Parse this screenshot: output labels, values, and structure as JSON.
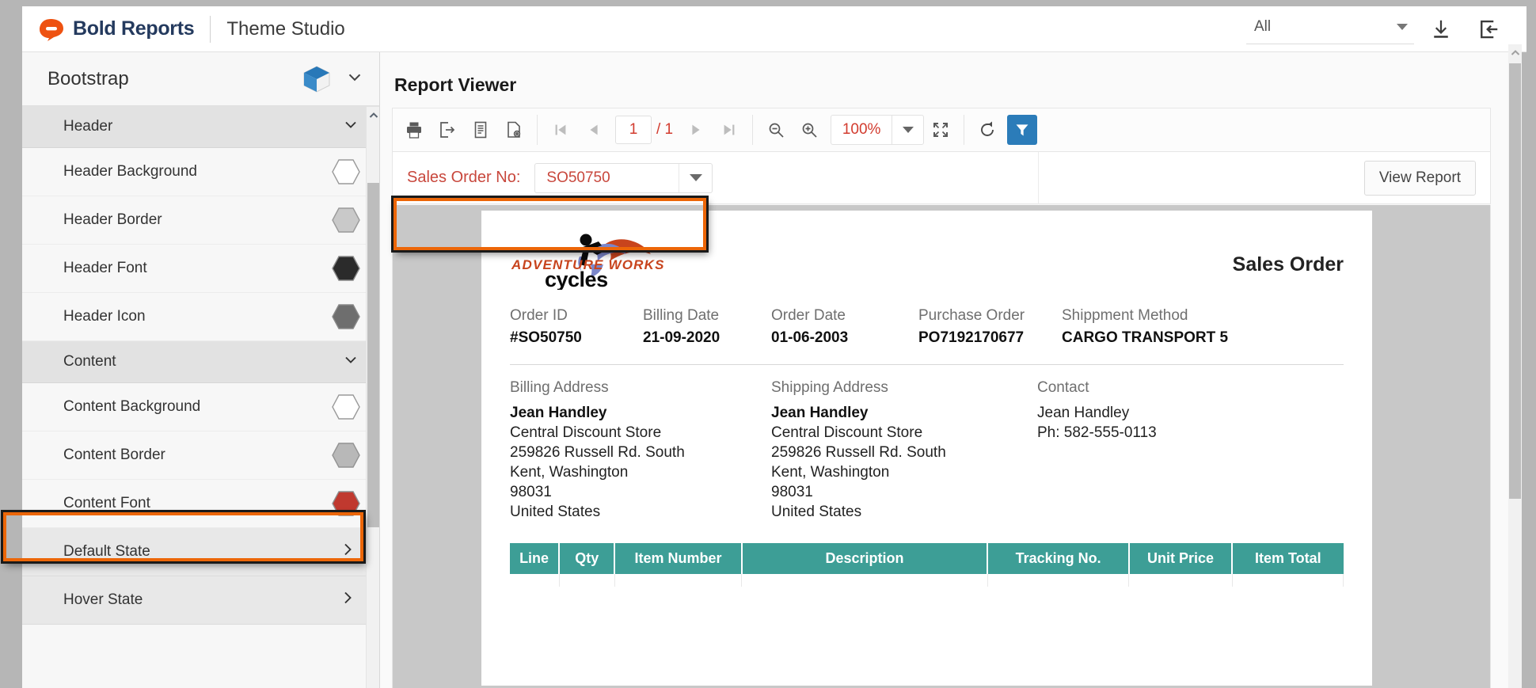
{
  "header": {
    "brand_name": "Bold Reports",
    "app_title": "Theme Studio",
    "filter_value": "All",
    "download_icon": "download-icon",
    "export_icon": "export-icon"
  },
  "sidebar": {
    "theme_name": "Bootstrap",
    "sections": [
      {
        "label": "Header",
        "expanded": true,
        "items": [
          {
            "label": "Header Background",
            "swatch": "#ffffff"
          },
          {
            "label": "Header Border",
            "swatch": "#c9c9c9"
          },
          {
            "label": "Header Font",
            "swatch": "#2b2b2b"
          },
          {
            "label": "Header Icon",
            "swatch": "#6e6e6e"
          }
        ]
      },
      {
        "label": "Content",
        "expanded": true,
        "items": [
          {
            "label": "Content Background",
            "swatch": "#ffffff"
          },
          {
            "label": "Content Border",
            "swatch": "#b8b8b8"
          },
          {
            "label": "Content Font",
            "swatch": "#c0392f",
            "highlighted": true
          }
        ]
      }
    ],
    "states": [
      {
        "label": "Default State"
      },
      {
        "label": "Hover State"
      }
    ]
  },
  "main": {
    "title": "Report Viewer",
    "toolbar": {
      "print_icon": "print-icon",
      "export_icon": "export-file-icon",
      "toc_icon": "document-icon",
      "page_setup_icon": "page-setup-icon",
      "first_page_icon": "first-page-icon",
      "prev_page_icon": "previous-page-icon",
      "next_page_icon": "next-page-icon",
      "last_page_icon": "last-page-icon",
      "current_page": "1",
      "page_total": "/ 1",
      "zoom_out_icon": "zoom-out-icon",
      "zoom_in_icon": "zoom-in-icon",
      "zoom_value": "100%",
      "fullscreen_icon": "fullscreen-icon",
      "refresh_icon": "refresh-icon",
      "filter_icon": "filter-icon"
    },
    "parameter": {
      "label": "Sales Order No:",
      "value": "SO50750",
      "view_report_label": "View Report"
    }
  },
  "report": {
    "logo_top_text": "ADVENTURE WORKS",
    "logo_bottom_text": "cycles",
    "doc_title": "Sales Order",
    "fields": [
      {
        "label": "Order ID",
        "value": "#SO50750"
      },
      {
        "label": "Billing Date",
        "value": "21-09-2020"
      },
      {
        "label": "Order Date",
        "value": "01-06-2003"
      },
      {
        "label": "Purchase Order",
        "value": "PO7192170677"
      },
      {
        "label": "Shippment Method",
        "value": "CARGO TRANSPORT 5"
      }
    ],
    "billing": {
      "title": "Billing Address",
      "name": "Jean Handley",
      "lines": [
        "Central Discount Store",
        "259826 Russell Rd. South",
        "Kent, Washington",
        "98031",
        "United States"
      ]
    },
    "shipping": {
      "title": "Shipping Address",
      "name": "Jean Handley",
      "lines": [
        "Central Discount Store",
        "259826 Russell Rd. South",
        "Kent, Washington",
        "98031",
        "United States"
      ]
    },
    "contact": {
      "title": "Contact",
      "name": "Jean Handley",
      "phone": "Ph: 582-555-0113"
    },
    "table": {
      "columns": [
        "Line",
        "Qty",
        "Item Number",
        "Description",
        "Tracking No.",
        "Unit Price",
        "Item Total"
      ],
      "header_bg": "#3d9e96"
    }
  },
  "colors": {
    "brand_orange": "#ee5211",
    "brand_navy": "#243a5e",
    "accent_red": "#c8473c",
    "filter_blue": "#2b7cb9",
    "annotation_orange": "#ec6608"
  }
}
